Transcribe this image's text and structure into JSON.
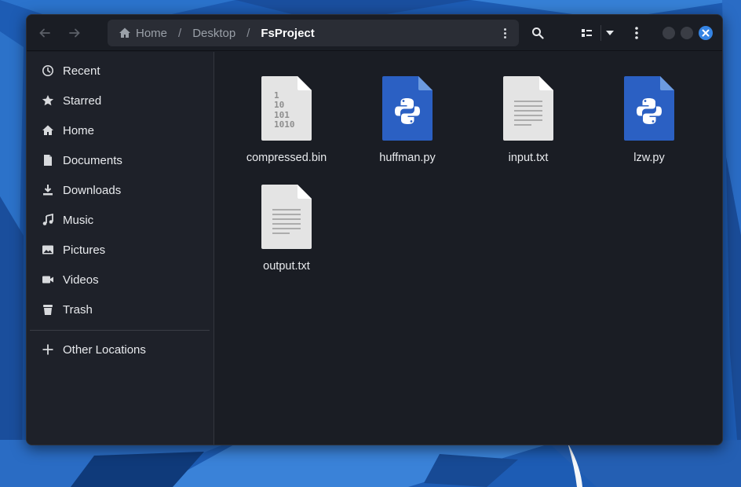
{
  "colors": {
    "window_bg": "#1a1d24",
    "sidebar_bg": "#1e2129",
    "pathbar_bg": "#2a2d35",
    "close_button": "#3584e4",
    "python_icon": "#2b60c3",
    "text_icon": "#e8e8e8"
  },
  "header": {
    "back_icon": "arrow-left-icon",
    "forward_icon": "arrow-right-icon",
    "breadcrumbs": [
      {
        "label": "Home",
        "icon": "home-icon"
      },
      {
        "label": "Desktop"
      },
      {
        "label": "FsProject",
        "current": true
      }
    ],
    "separator": "/",
    "search_icon": "search-icon",
    "view_icon": "list-view-icon",
    "view_dropdown_icon": "chevron-down-icon",
    "menu_icon": "kebab-menu-icon"
  },
  "sidebar": {
    "items": [
      {
        "label": "Recent",
        "icon": "clock-icon"
      },
      {
        "label": "Starred",
        "icon": "star-icon"
      },
      {
        "label": "Home",
        "icon": "home-icon"
      },
      {
        "label": "Documents",
        "icon": "document-icon"
      },
      {
        "label": "Downloads",
        "icon": "download-icon"
      },
      {
        "label": "Music",
        "icon": "music-icon"
      },
      {
        "label": "Pictures",
        "icon": "picture-icon"
      },
      {
        "label": "Videos",
        "icon": "video-icon"
      },
      {
        "label": "Trash",
        "icon": "trash-icon"
      }
    ],
    "other_locations": {
      "label": "Other Locations",
      "icon": "plus-icon"
    }
  },
  "files": [
    {
      "name": "compressed.bin",
      "type": "binary",
      "binary_lines": [
        "1",
        "10",
        "101",
        "1010"
      ]
    },
    {
      "name": "huffman.py",
      "type": "python"
    },
    {
      "name": "input.txt",
      "type": "text"
    },
    {
      "name": "lzw.py",
      "type": "python"
    },
    {
      "name": "output.txt",
      "type": "text"
    }
  ]
}
